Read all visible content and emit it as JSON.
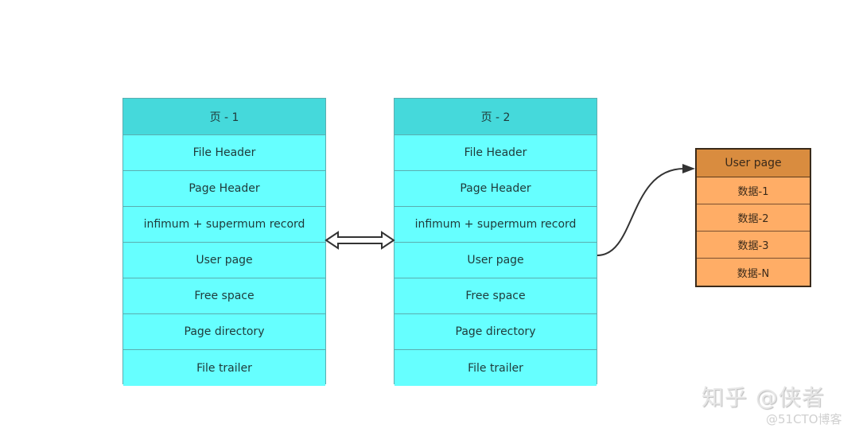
{
  "pages": [
    {
      "title": "页 - 1",
      "rows": [
        "File Header",
        "Page Header",
        "infimum + supermum record",
        "User page",
        "Free space",
        "Page directory",
        "File trailer"
      ]
    },
    {
      "title": "页 - 2",
      "rows": [
        "File Header",
        "Page Header",
        "infimum + supermum record",
        "User page",
        "Free space",
        "Page directory",
        "File trailer"
      ]
    }
  ],
  "user_page": {
    "title": "User page",
    "rows": [
      "数据-1",
      "数据-2",
      "数据-3",
      "数据-N"
    ]
  },
  "connectors": {
    "page_link": "double-arrow-icon",
    "user_page_link": "curved-arrow-icon"
  },
  "colors": {
    "page_header": "#45d9db",
    "page_row": "#66ffff",
    "user_header": "#d98c3f",
    "user_row": "#ffad66"
  },
  "watermark": {
    "main": "知乎 @侠者",
    "sub": "@51CTO博客"
  }
}
